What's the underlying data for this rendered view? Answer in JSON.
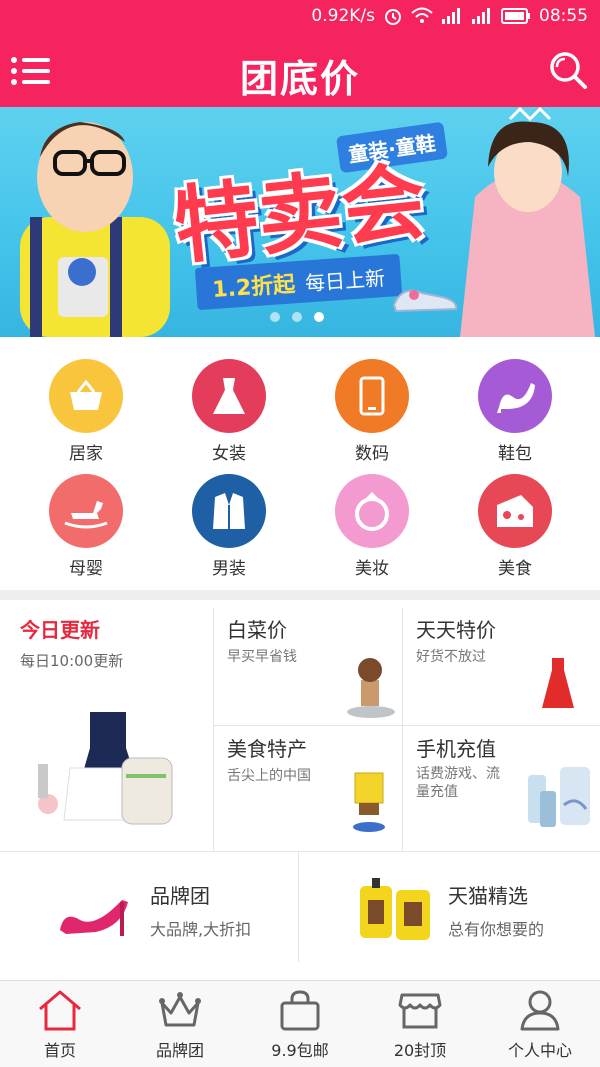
{
  "status_bar": {
    "speed": "0.92K/s",
    "time": "08:55"
  },
  "header": {
    "title": "团底价"
  },
  "banner": {
    "tag": "童装·童鞋",
    "headline": "特卖会",
    "discount": "1.2折起",
    "tagline": "每日上新",
    "slides": 3,
    "active_slide": 3
  },
  "categories": [
    {
      "label": "居家",
      "icon": "basket-icon",
      "color": "#f9c53d"
    },
    {
      "label": "女装",
      "icon": "dress-icon",
      "color": "#e33d5b"
    },
    {
      "label": "数码",
      "icon": "phone-icon",
      "color": "#f07a26"
    },
    {
      "label": "鞋包",
      "icon": "high-heel-icon",
      "color": "#a55bd6"
    },
    {
      "label": "母婴",
      "icon": "rocking-horse-icon",
      "color": "#f26c6c"
    },
    {
      "label": "男装",
      "icon": "suit-icon",
      "color": "#1f5fa6"
    },
    {
      "label": "美妆",
      "icon": "ring-icon",
      "color": "#f39bd0"
    },
    {
      "label": "美食",
      "icon": "cheese-icon",
      "color": "#e84756"
    }
  ],
  "promo": {
    "today": {
      "title": "今日更新",
      "sub": "每日10:00更新"
    },
    "cells": [
      {
        "title": "白菜价",
        "sub": "早买早省钱"
      },
      {
        "title": "天天特价",
        "sub": "好货不放过"
      },
      {
        "title": "美食特产",
        "sub": "舌尖上的中国"
      },
      {
        "title": "手机充值",
        "sub": "话费游戏、流量充值"
      }
    ]
  },
  "brand": [
    {
      "title": "品牌团",
      "sub": "大品牌,大折扣"
    },
    {
      "title": "天猫精选",
      "sub": "总有你想要的"
    }
  ],
  "tabs": [
    {
      "label": "首页",
      "icon": "home-icon",
      "active": true
    },
    {
      "label": "品牌团",
      "icon": "crown-icon"
    },
    {
      "label": "9.9包邮",
      "icon": "shopping-bag-icon"
    },
    {
      "label": "20封顶",
      "icon": "store-icon"
    },
    {
      "label": "个人中心",
      "icon": "user-icon"
    }
  ],
  "colors": {
    "brand": "#f5245f",
    "accent_red": "#e8283e"
  }
}
